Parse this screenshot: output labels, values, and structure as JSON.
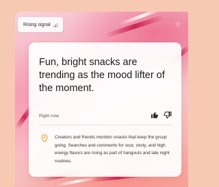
{
  "badge": {
    "label": "Rising signal",
    "icon": "signal-bars-icon"
  },
  "card": {
    "headline": "Fun, bright snacks are trending as the mood lifter of the moment.",
    "timestamp": "Right now",
    "body": "Creators and friends mention snacks that keep the group going. Searches and comments for sour, zesty, and high energy flavors are rising as part of hangouts and late night routines."
  },
  "icons": {
    "favorite": "star-icon",
    "feedback_up": "thumbs-up-icon",
    "feedback_down": "thumbs-down-icon",
    "location": "location-pin-icon"
  },
  "colors": {
    "background": "#f7c9b2",
    "accent_pink": "#e84870",
    "pin": "#e8a83a"
  }
}
